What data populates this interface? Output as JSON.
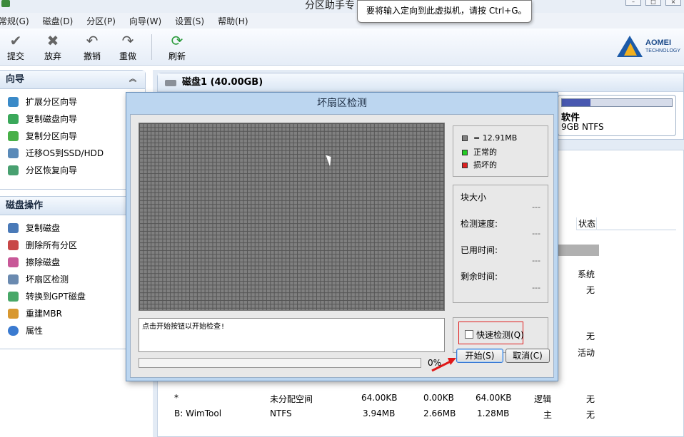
{
  "window": {
    "title": "分区助手专"
  },
  "menu": [
    "常规(G)",
    "磁盘(D)",
    "分区(P)",
    "向导(W)",
    "设置(S)",
    "帮助(H)"
  ],
  "toolbar": {
    "commit": "提交",
    "discard": "放弃",
    "undo": "撤销",
    "redo": "重做",
    "refresh": "刷新"
  },
  "logo": {
    "brand": "AOMEI",
    "sub": "TECHNOLOGY"
  },
  "tooltip": "要将输入定向到此虚拟机，请按 Ctrl+G。",
  "wizard_panel": {
    "title": "向导",
    "items": [
      "扩展分区向导",
      "复制磁盘向导",
      "复制分区向导",
      "迁移OS到SSD/HDD",
      "分区恢复向导"
    ]
  },
  "disk_panel": {
    "title": "磁盘操作",
    "items": [
      "复制磁盘",
      "删除所有分区",
      "擦除磁盘",
      "坏扇区检测",
      "转换到GPT磁盘",
      "重建MBR",
      "属性"
    ]
  },
  "disk_card": {
    "title": "磁盘1 (40.00GB)",
    "partition_name": "软件",
    "partition_info": "9GB NTFS"
  },
  "table": {
    "status_header": "状态",
    "status_values": [
      "系统",
      "无",
      "无",
      "活动"
    ],
    "rows": [
      {
        "name": "*",
        "fs": "未分配空间",
        "capacity": "64.00KB",
        "used": "0.00KB",
        "free": "64.00KB",
        "type": "逻辑",
        "status": "无"
      },
      {
        "name": "B: WimTool",
        "fs": "NTFS",
        "capacity": "3.94MB",
        "used": "2.66MB",
        "free": "1.28MB",
        "type": "主",
        "status": "无"
      }
    ]
  },
  "dialog": {
    "title": "坏扇区检测",
    "legend": {
      "block": "= 12.91MB",
      "normal": "正常的",
      "bad": "损坏的"
    },
    "stats": {
      "block_size_label": "块大小",
      "block_size_value": "---",
      "speed_label": "检测速度:",
      "speed_value": "---",
      "elapsed_label": "已用时间:",
      "elapsed_value": "---",
      "remaining_label": "剩余时间:",
      "remaining_value": "---"
    },
    "message": "点击开始按钮以开始检查!",
    "progress": 0,
    "progress_text": "0%",
    "quick_check_label": "快速检测(Q)",
    "start_label": "开始(S)",
    "cancel_label": "取消(C)"
  },
  "colors": {
    "block": "#808080",
    "normal": "#22cc22",
    "bad": "#dd2020",
    "accent": "#3a7bd5"
  }
}
